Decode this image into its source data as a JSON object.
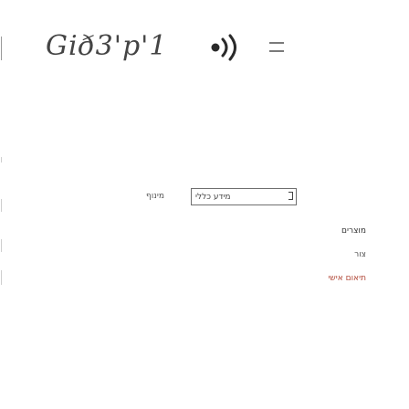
{
  "header": {
    "logo_text": "Gið3'p'1",
    "menu_icon": "hamburger-icon",
    "logo_mark_icon": "sound-waves-icon"
  },
  "tabs": {
    "contacts_label": "מינוף",
    "about_label": "מידע כללי"
  },
  "nav": {
    "items": [
      {
        "label": "מוצרים"
      },
      {
        "label": "צור"
      },
      {
        "label": "תיאום אישי"
      }
    ]
  },
  "colors": {
    "background": "#ffffff",
    "text": "#444444",
    "accent": "#b24a3a",
    "border": "#6f6f6f"
  }
}
